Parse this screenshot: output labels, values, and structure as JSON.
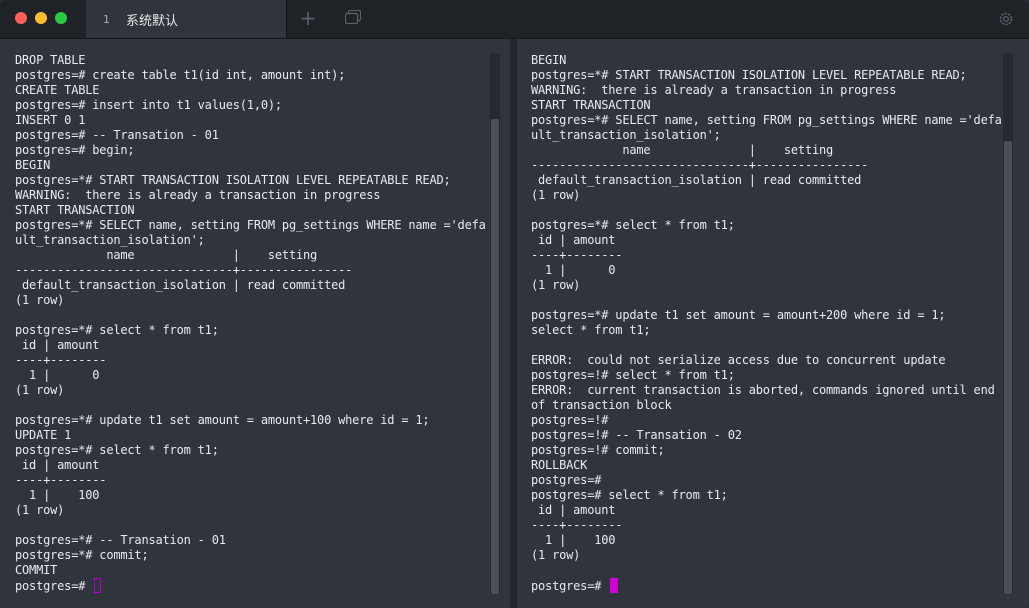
{
  "window": {
    "tab_number": "1",
    "tab_title": "系统默认",
    "colors": {
      "background": "#2f343d",
      "titlebar": "#1f2227",
      "text": "#e8eaed",
      "cursor": "#d200d6"
    },
    "icons": [
      "close-icon",
      "minimize-icon",
      "zoom-icon",
      "plus-icon",
      "tabs-overview-icon",
      "gear-icon"
    ]
  },
  "left_pane": {
    "lines": [
      "DROP TABLE",
      "postgres=# create table t1(id int, amount int);",
      "CREATE TABLE",
      "postgres=# insert into t1 values(1,0);",
      "INSERT 0 1",
      "postgres=# -- Transation - 01",
      "postgres=# begin;",
      "BEGIN",
      "postgres=*# START TRANSACTION ISOLATION LEVEL REPEATABLE READ;",
      "WARNING:  there is already a transaction in progress",
      "START TRANSACTION",
      "postgres=*# SELECT name, setting FROM pg_settings WHERE name ='defa",
      "ult_transaction_isolation';",
      "             name              |    setting",
      "-------------------------------+----------------",
      " default_transaction_isolation | read committed",
      "(1 row)",
      "",
      "postgres=*# select * from t1;",
      " id | amount",
      "----+--------",
      "  1 |      0",
      "(1 row)",
      "",
      "postgres=*# update t1 set amount = amount+100 where id = 1;",
      "UPDATE 1",
      "postgres=*# select * from t1;",
      " id | amount",
      "----+--------",
      "  1 |    100",
      "(1 row)",
      "",
      "postgres=*# -- Transation - 01",
      "postgres=*# commit;",
      "COMMIT"
    ],
    "prompt": "postgres=# "
  },
  "right_pane": {
    "lines": [
      "BEGIN",
      "postgres=*# START TRANSACTION ISOLATION LEVEL REPEATABLE READ;",
      "WARNING:  there is already a transaction in progress",
      "START TRANSACTION",
      "postgres=*# SELECT name, setting FROM pg_settings WHERE name ='defa",
      "ult_transaction_isolation';",
      "             name              |    setting",
      "-------------------------------+----------------",
      " default_transaction_isolation | read committed",
      "(1 row)",
      "",
      "postgres=*# select * from t1;",
      " id | amount",
      "----+--------",
      "  1 |      0",
      "(1 row)",
      "",
      "postgres=*# update t1 set amount = amount+200 where id = 1;",
      "select * from t1;",
      "",
      "ERROR:  could not serialize access due to concurrent update",
      "postgres=!# select * from t1;",
      "ERROR:  current transaction is aborted, commands ignored until end",
      "of transaction block",
      "postgres=!#",
      "postgres=!# -- Transation - 02",
      "postgres=!# commit;",
      "ROLLBACK",
      "postgres=#",
      "postgres=# select * from t1;",
      " id | amount",
      "----+--------",
      "  1 |    100",
      "(1 row)",
      ""
    ],
    "prompt": "postgres=# "
  }
}
